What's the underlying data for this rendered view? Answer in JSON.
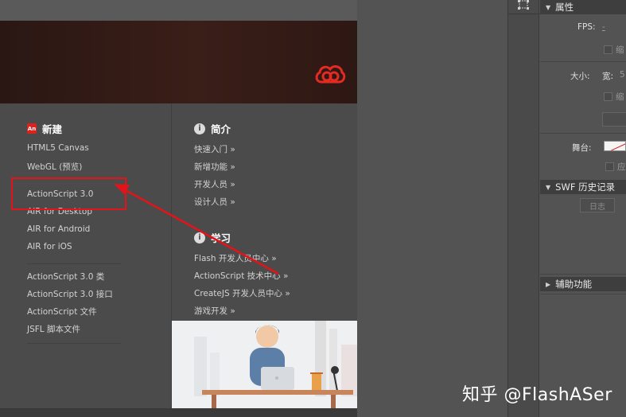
{
  "welcome": {
    "new_section": {
      "badge": "An",
      "title": "新建",
      "items": [
        "HTML5 Canvas",
        "WebGL (预览)",
        "ActionScript 3.0",
        "AIR for Desktop",
        "AIR for Android",
        "AIR for iOS"
      ],
      "file_items": [
        "ActionScript 3.0 类",
        "ActionScript 3.0 接口",
        "ActionScript 文件",
        "JSFL 脚本文件"
      ]
    },
    "intro_section": {
      "title": "简介",
      "items": [
        "快速入门 »",
        "新增功能 »",
        "开发人员 »",
        "设计人员 »"
      ]
    },
    "learn_section": {
      "title": "学习",
      "items": [
        "Flash 开发人员中心 »",
        "ActionScript 技术中心 »",
        "CreateJS 开发人员中心 »",
        "游戏开发 »"
      ]
    },
    "logo_icon": "creative-cloud-logo",
    "highlight_color": "#e2141a"
  },
  "properties_panel": {
    "title": "属性",
    "fps_label": "FPS:",
    "fps_value": "-",
    "scale_label": "缩",
    "size_label": "大小:",
    "width_label": "宽:",
    "width_value": "5",
    "scale_label2": "缩",
    "stage_label": "舞台:",
    "apply_label": "应",
    "swf_history_title": "SWF 历史记录",
    "log_button": "日志",
    "accessibility_title": "辅助功能"
  },
  "watermark": "知乎 @FlashASer"
}
